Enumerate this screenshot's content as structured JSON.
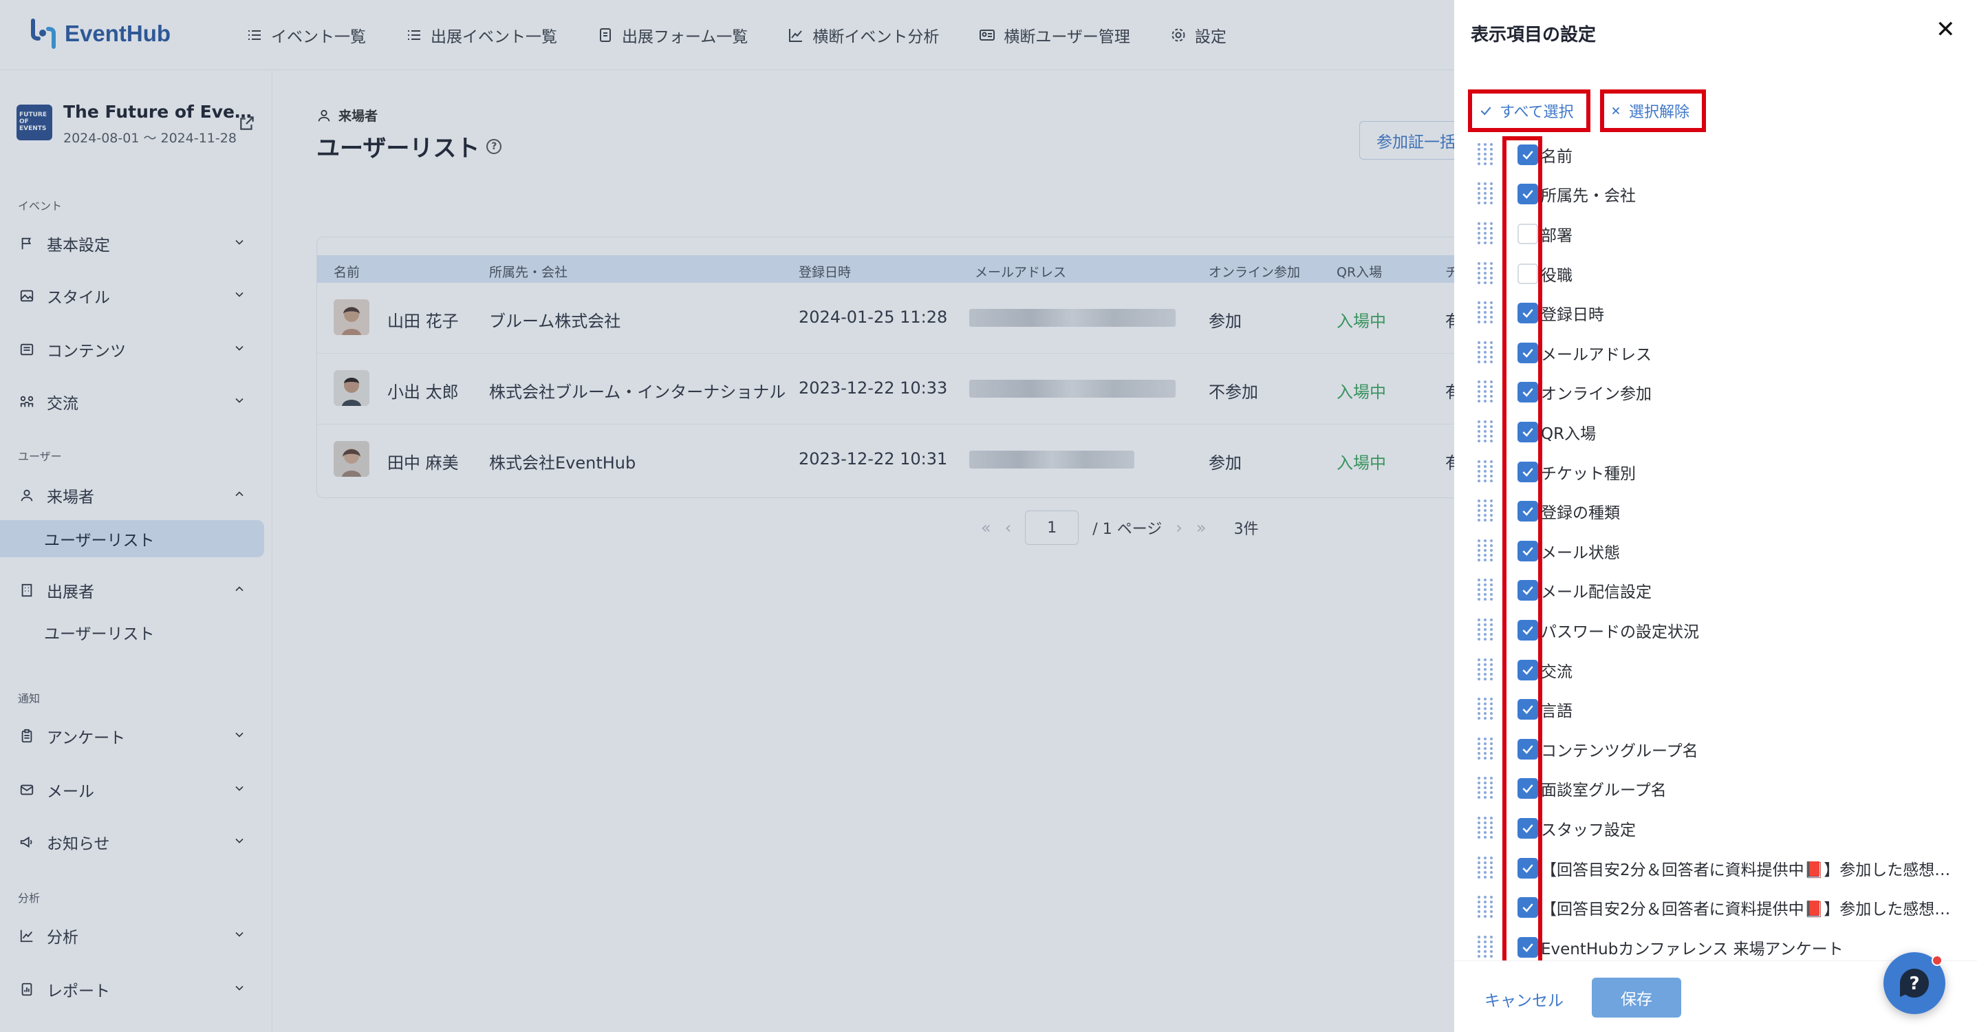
{
  "app": {
    "name": "EventHub"
  },
  "nav": [
    "イベント一覧",
    "出展イベント一覧",
    "出展フォーム一覧",
    "横断イベント分析",
    "横断ユーザー管理",
    "設定"
  ],
  "event": {
    "thumb": "FUTURE OF EVENTS",
    "name": "The Future of Eve…",
    "dates": "2024-08-01 ～ 2024-11-28"
  },
  "sidebar": {
    "sections": [
      "イベント",
      "ユーザー",
      "通知",
      "分析"
    ],
    "items": [
      "基本設定",
      "スタイル",
      "コンテンツ",
      "交流",
      "来場者",
      "ユーザーリスト",
      "出展者",
      "ユーザーリスト",
      "アンケート",
      "メール",
      "お知らせ",
      "分析",
      "レポート"
    ]
  },
  "page": {
    "breadcrumb": "来場者",
    "title": "ユーザーリスト",
    "top_button": "参加証一括"
  },
  "table": {
    "headers": [
      "名前",
      "所属先・会社",
      "登録日時",
      "メールアドレス",
      "オンライン参加",
      "QR入場",
      "チ"
    ],
    "rows": [
      {
        "name": "山田 花子",
        "company": "ブルーム株式会社",
        "registered": "2024-01-25 11:28",
        "online": "参加",
        "qr": "入場中",
        "extra": "有"
      },
      {
        "name": "小出 太郎",
        "company": "株式会社ブルーム・インターナショナル",
        "registered": "2023-12-22 10:33",
        "online": "不参加",
        "qr": "入場中",
        "extra": "有"
      },
      {
        "name": "田中 麻美",
        "company": "株式会社EventHub",
        "registered": "2023-12-22 10:31",
        "online": "参加",
        "qr": "入場中",
        "extra": "有"
      }
    ]
  },
  "pager": {
    "current": "1",
    "total": "/ 1 ページ",
    "count": "3件"
  },
  "drawer": {
    "title": "表示項目の設定",
    "select_all": "すべて選択",
    "deselect": "選択解除",
    "cancel": "キャンセル",
    "save": "保存",
    "fields": [
      {
        "label": "名前",
        "checked": true
      },
      {
        "label": "所属先・会社",
        "checked": true
      },
      {
        "label": "部署",
        "checked": false
      },
      {
        "label": "役職",
        "checked": false
      },
      {
        "label": "登録日時",
        "checked": true
      },
      {
        "label": "メールアドレス",
        "checked": true
      },
      {
        "label": "オンライン参加",
        "checked": true
      },
      {
        "label": "QR入場",
        "checked": true
      },
      {
        "label": "チケット種別",
        "checked": true
      },
      {
        "label": "登録の種類",
        "checked": true
      },
      {
        "label": "メール状態",
        "checked": true
      },
      {
        "label": "メール配信設定",
        "checked": true
      },
      {
        "label": "パスワードの設定状況",
        "checked": true
      },
      {
        "label": "交流",
        "checked": true
      },
      {
        "label": "言語",
        "checked": true
      },
      {
        "label": "コンテンツグループ名",
        "checked": true
      },
      {
        "label": "面談室グループ名",
        "checked": true
      },
      {
        "label": "スタッフ設定",
        "checked": true
      },
      {
        "label": "【回答目安2分＆回答者に資料提供中📕】参加した感想を…",
        "checked": true
      },
      {
        "label": "【回答目安2分＆回答者に資料提供中📕】参加した感想を…",
        "checked": true
      },
      {
        "label": "EventHubカンファレンス 来場アンケート",
        "checked": true
      }
    ]
  },
  "colors": {
    "accent": "#3d7bd1",
    "highlight": "#d8000f",
    "success": "#3aa55c"
  }
}
